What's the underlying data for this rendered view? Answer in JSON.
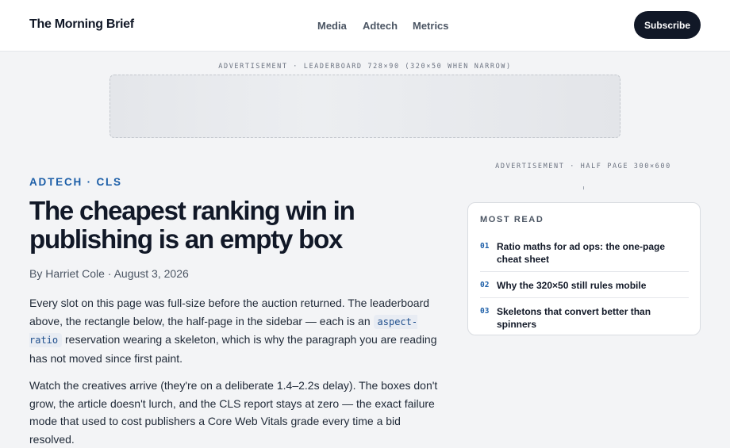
{
  "header": {
    "logo": "The Morning Brief",
    "nav": [
      "Media",
      "Adtech",
      "Metrics"
    ],
    "subscribe_label": "Subscribe"
  },
  "ads": {
    "leaderboard_label": "ADVERTISEMENT · LEADERBOARD 728×90 (320×50 WHEN NARROW)",
    "half_page_label": "ADVERTISEMENT · HALF PAGE 300×600"
  },
  "article": {
    "kicker": "ADTECH · CLS",
    "headline": "The cheapest ranking win in publishing is an empty box",
    "byline": "By Harriet Cole · August 3, 2026",
    "p1_before": "Every slot on this page was full-size before the auction returned. The leaderboard above, the rectangle below, the half-page in the sidebar — each is an ",
    "p1_code": "aspect-ratio",
    "p1_after": " reservation wearing a skeleton, which is why the paragraph you are reading has not moved since first paint.",
    "p2": "Watch the creatives arrive (they're on a deliberate 1.4–2.2s delay). The boxes don't grow, the article doesn't lurch, and the CLS report stays at zero — the exact failure mode that used to cost publishers a Core Web Vitals grade every time a bid resolved."
  },
  "most_read": {
    "title": "MOST READ",
    "items": [
      {
        "num": "01",
        "text": "Ratio maths for ad ops: the one-page cheat sheet"
      },
      {
        "num": "02",
        "text": "Why the 320×50 still rules mobile"
      },
      {
        "num": "03",
        "text": "Skeletons that convert better than spinners"
      }
    ]
  },
  "colors": {
    "accent": "#1d5fa8",
    "button_bg": "#111827",
    "page_bg": "#f3f4f6"
  }
}
